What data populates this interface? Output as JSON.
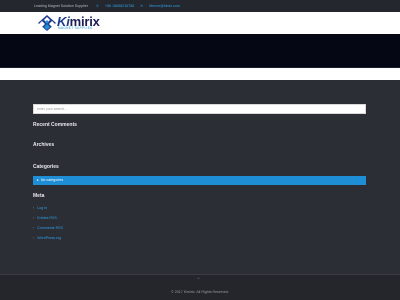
{
  "topbar": {
    "tagline": "Leading Magnet Solution Supplier",
    "phone": "+86 18658216788",
    "email": "Mercer@kimix.com"
  },
  "header": {
    "brand_ki": "Ki",
    "brand_mirix": "mirix",
    "brand_sub": "MAGNET SUPPLIES"
  },
  "sidebar": {
    "search_placeholder": "enter your search...",
    "recent_comments_title": "Recent Comments",
    "archives_title": "Archives",
    "categories_title": "Categories",
    "categories": [
      "No categories"
    ],
    "meta_title": "Meta",
    "meta_links": [
      "Log in",
      "Entries RSS",
      "Comments RSS",
      "WordPress.org"
    ]
  },
  "footer": {
    "copyright": "© 2017 Kimirix. All Rights Reserved."
  },
  "colors": {
    "accent": "#1e8fd6",
    "brand_navy": "#1b2c73",
    "background": "#2c2e35"
  }
}
